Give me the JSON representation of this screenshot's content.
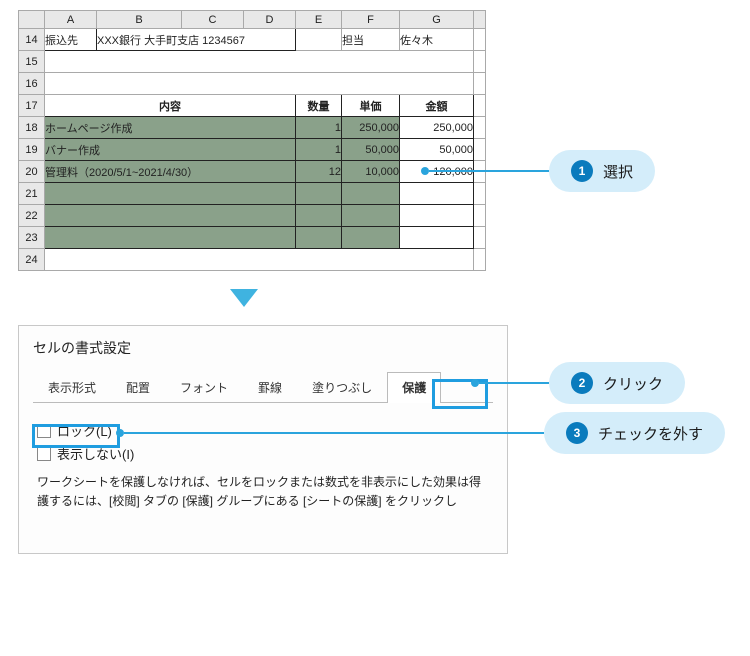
{
  "spreadsheet": {
    "cols": [
      "A",
      "B",
      "C",
      "D",
      "E",
      "F",
      "G",
      ""
    ],
    "rows": [
      "14",
      "15",
      "16",
      "17",
      "18",
      "19",
      "20",
      "21",
      "22",
      "23",
      "24"
    ],
    "r14": {
      "a": "振込先",
      "bcd": "XXX銀行 大手町支店 1234567",
      "f": "担当",
      "g": "佐々木"
    },
    "hdr": {
      "content": "内容",
      "qty": "数量",
      "price": "単価",
      "amount": "金額"
    },
    "r18": {
      "content": "ホームページ作成",
      "qty": "1",
      "price": "250,000",
      "amount": "250,000"
    },
    "r19": {
      "content": "バナー作成",
      "qty": "1",
      "price": "50,000",
      "amount": "50,000"
    },
    "r20": {
      "content": "管理料（2020/5/1~2021/4/30）",
      "qty": "12",
      "price": "10,000",
      "amount": "120,000"
    }
  },
  "dialog": {
    "title": "セルの書式設定",
    "tabs": [
      "表示形式",
      "配置",
      "フォント",
      "罫線",
      "塗りつぶし",
      "保護"
    ],
    "opt_lock": "ロック(L)",
    "opt_hide": "表示しない(I)",
    "note": "ワークシートを保護しなければ、セルをロックまたは数式を非表示にした効果は得護するには、[校閲] タブの [保護] グループにある [シートの保護] をクリックし"
  },
  "callouts": {
    "c1": {
      "n": "1",
      "label": "選択"
    },
    "c2": {
      "n": "2",
      "label": "クリック"
    },
    "c3": {
      "n": "3",
      "label": "チェックを外す"
    }
  }
}
